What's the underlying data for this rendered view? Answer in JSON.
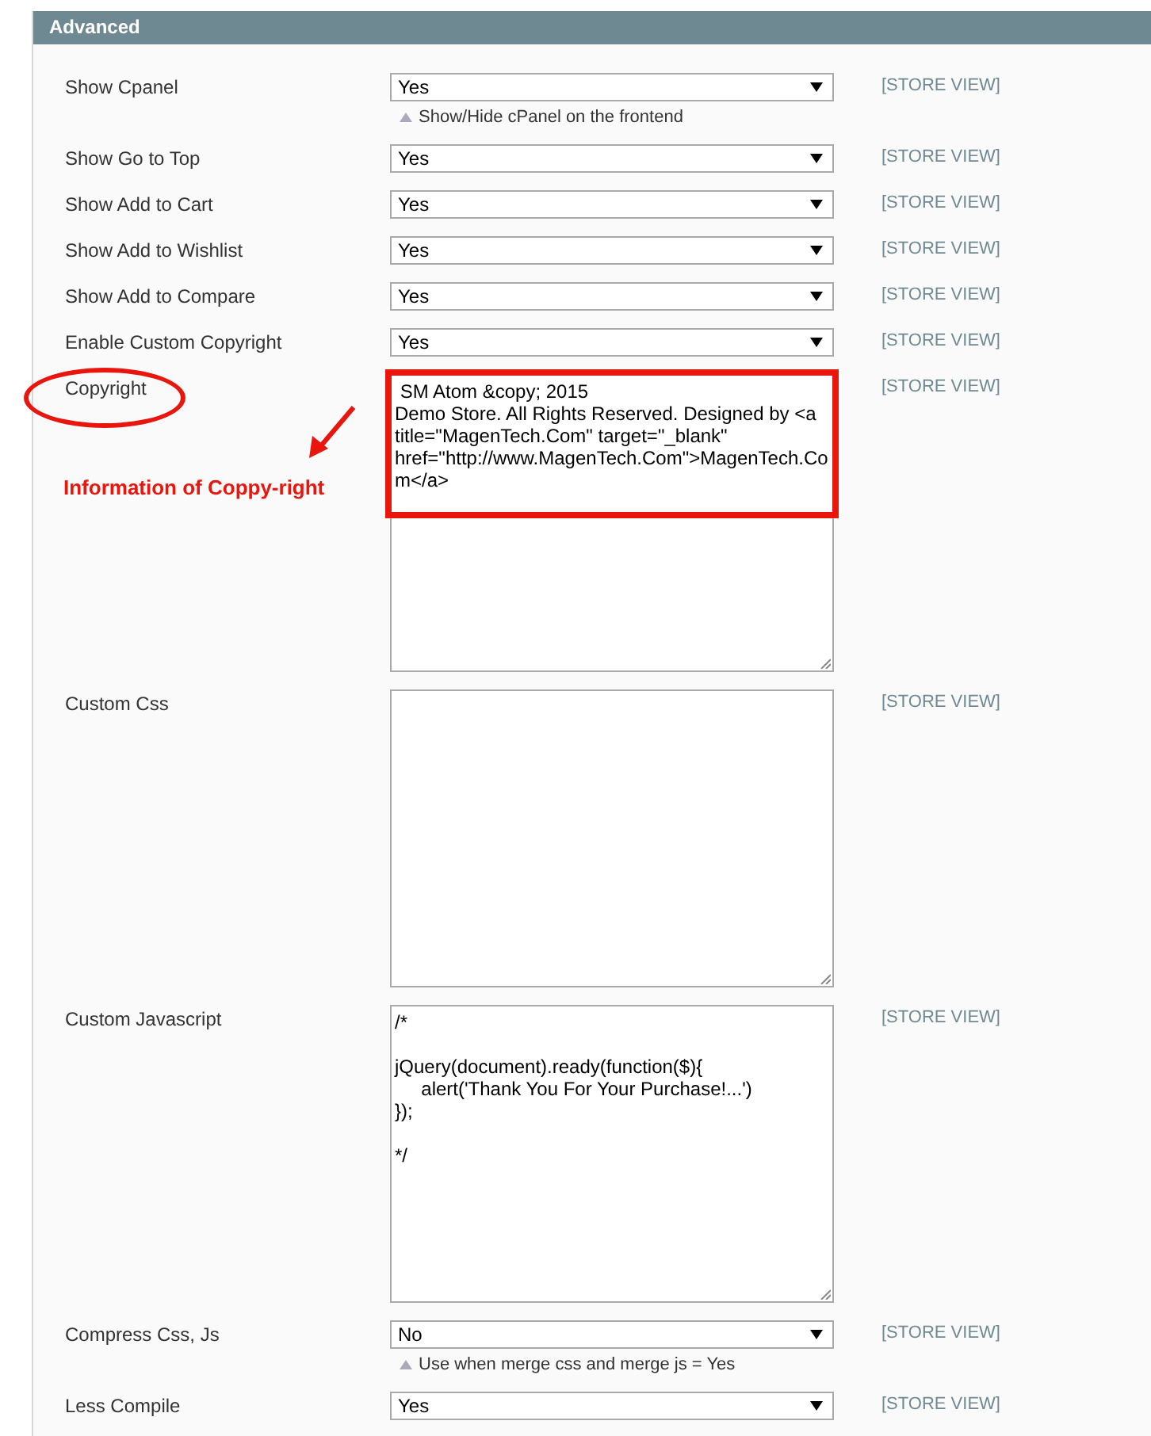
{
  "section": {
    "title": "Advanced"
  },
  "rows": [
    {
      "kind": "select",
      "label": "Show Cpanel",
      "value": "Yes",
      "note": "Show/Hide cPanel on the frontend",
      "scope": "[STORE VIEW]"
    },
    {
      "kind": "select",
      "label": "Show Go to Top",
      "value": "Yes",
      "scope": "[STORE VIEW]"
    },
    {
      "kind": "select",
      "label": "Show Add to Cart",
      "value": "Yes",
      "scope": "[STORE VIEW]"
    },
    {
      "kind": "select",
      "label": "Show Add to Wishlist",
      "value": "Yes",
      "scope": "[STORE VIEW]"
    },
    {
      "kind": "select",
      "label": "Show Add to Compare",
      "value": "Yes",
      "scope": "[STORE VIEW]"
    },
    {
      "kind": "select",
      "label": "Enable Custom Copyright",
      "value": "Yes",
      "scope": "[STORE VIEW]"
    },
    {
      "kind": "textarea",
      "label": "Copyright",
      "value": " SM Atom &copy; 2015\nDemo Store. All Rights Reserved. Designed by <a title=\"MagenTech.Com\" target=\"_blank\" href=\"http://www.MagenTech.Com\">MagenTech.Com</a>",
      "scope": "[STORE VIEW]"
    },
    {
      "kind": "textarea",
      "label": "Custom Css",
      "value": "",
      "scope": "[STORE VIEW]"
    },
    {
      "kind": "textarea",
      "label": "Custom Javascript",
      "value": "/*\n\njQuery(document).ready(function($){\n     alert('Thank You For Your Purchase!...')\n});\n\n*/",
      "scope": "[STORE VIEW]"
    },
    {
      "kind": "select",
      "label": "Compress Css, Js",
      "value": "No",
      "note": "Use when merge css and merge js = Yes",
      "scope": "[STORE VIEW]"
    },
    {
      "kind": "select",
      "label": "Less Compile",
      "value": "Yes",
      "scope": "[STORE VIEW]"
    }
  ],
  "annotation": {
    "text": "Information of Coppy-right"
  }
}
